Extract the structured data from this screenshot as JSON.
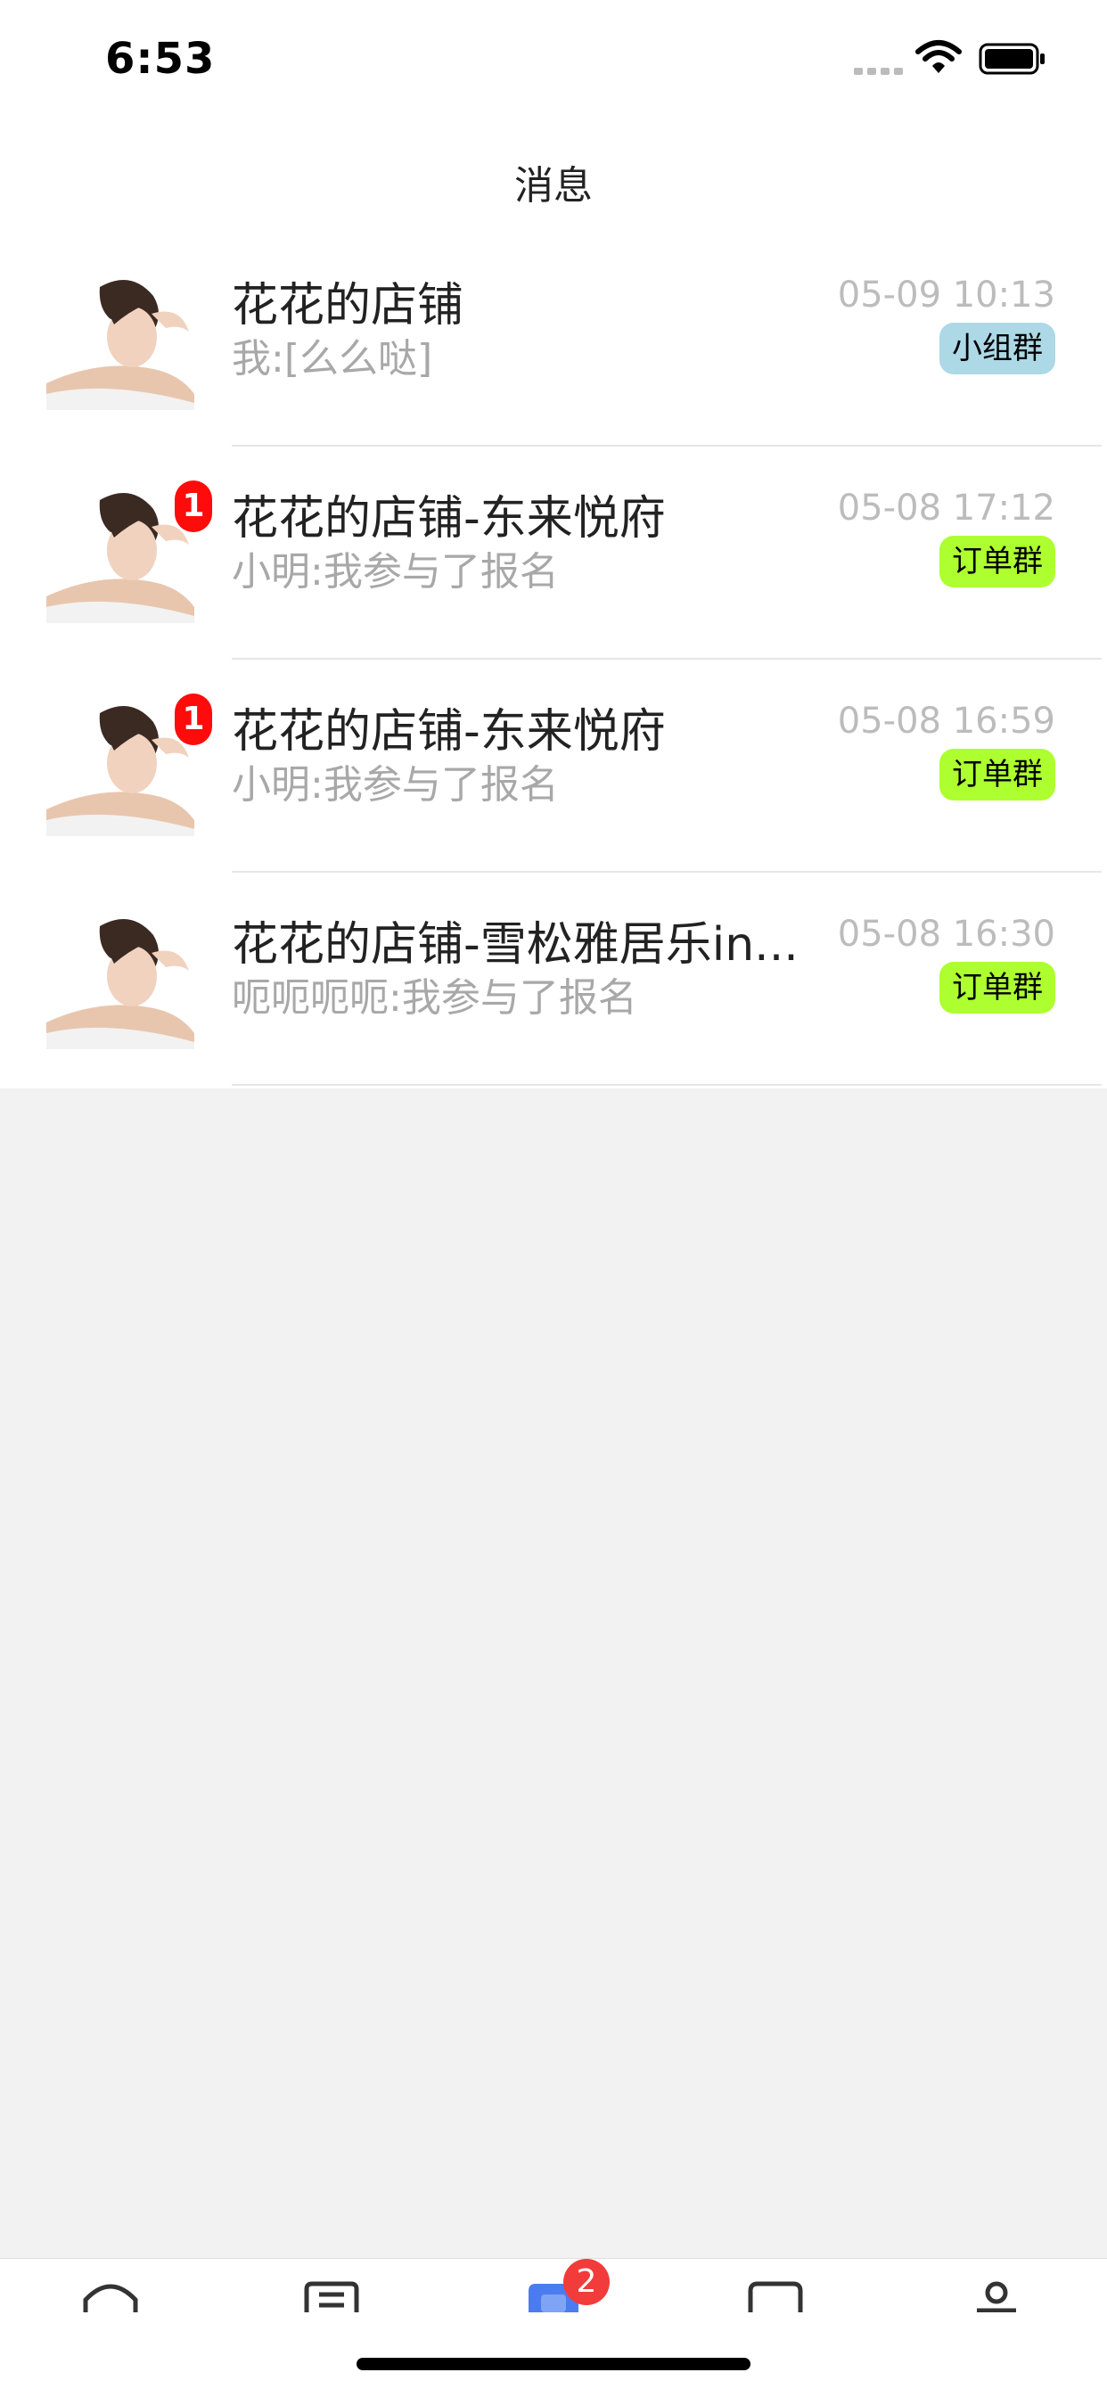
{
  "status_bar": {
    "time": "6:53"
  },
  "header": {
    "title": "消息"
  },
  "conversations": [
    {
      "name": "花花的店铺",
      "preview": "我:[么么哒]",
      "time": "05-09 10:13",
      "tag": "小组群",
      "tag_color": "#add8e6",
      "unread": ""
    },
    {
      "name": "花花的店铺-东来悦府",
      "preview": "小明:我参与了报名",
      "time": "05-08 17:12",
      "tag": "订单群",
      "tag_color": "#adff2f",
      "unread": "1"
    },
    {
      "name": "花花的店铺-东来悦府",
      "preview": "小明:我参与了报名",
      "time": "05-08 16:59",
      "tag": "订单群",
      "tag_color": "#adff2f",
      "unread": "1"
    },
    {
      "name": "花花的店铺-雪松雅居乐in...",
      "preview": "呃呃呃呃:我参与了报名",
      "time": "05-08 16:30",
      "tag": "订单群",
      "tag_color": "#adff2f",
      "unread": ""
    }
  ],
  "tab_bar": {
    "items": [
      {
        "icon": "home-icon"
      },
      {
        "icon": "orders-icon"
      },
      {
        "icon": "messages-icon"
      },
      {
        "icon": "chat-icon"
      },
      {
        "icon": "profile-icon"
      }
    ],
    "messages_badge": "2",
    "active_color": "#4a7cf0"
  }
}
